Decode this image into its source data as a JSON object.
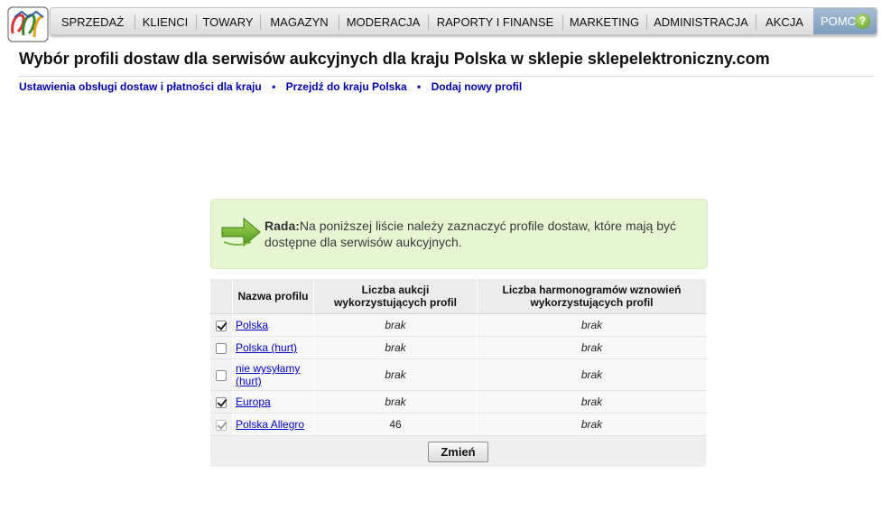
{
  "menu": {
    "items": [
      {
        "label": "SPRZEDAŻ",
        "name": "menu-item-sprzedaz"
      },
      {
        "label": "KLIENCI",
        "name": "menu-item-klienci"
      },
      {
        "label": "TOWARY",
        "name": "menu-item-towary"
      },
      {
        "label": "MAGAZYN",
        "name": "menu-item-magazyn"
      },
      {
        "label": "MODERACJA",
        "name": "menu-item-moderacja"
      },
      {
        "label": "RAPORTY I FINANSE",
        "name": "menu-item-raporty-i-finanse"
      },
      {
        "label": "MARKETING",
        "name": "menu-item-marketing"
      },
      {
        "label": "ADMINISTRACJA",
        "name": "menu-item-administracja"
      },
      {
        "label": "AKCJA",
        "name": "menu-item-akcja"
      }
    ],
    "help_label": "POMOC",
    "help_icon": "question-icon",
    "help_color": "#7d9bbc"
  },
  "page": {
    "title": "Wybór profili dostaw dla serwisów aukcyjnych dla kraju Polska w sklepie sklepelektroniczny.com"
  },
  "links": [
    {
      "label": "Ustawienia obsługi dostaw i płatności dla kraju",
      "name": "link-ustawienia-dostaw"
    },
    {
      "label": "Przejdź do kraju Polska",
      "name": "link-przejdz-do-kraju"
    },
    {
      "label": "Dodaj nowy profil",
      "name": "link-dodaj-profil"
    }
  ],
  "tip": {
    "label": "Rada:",
    "text": "Na poniższej liście należy zaznaczyć profile dostaw, które mają być dostępne dla serwisów aukcyjnych.",
    "icon": "green-arrow-icon",
    "background": "#e6f6d2"
  },
  "table": {
    "headers": {
      "name": "Nazwa profilu",
      "auctions": "Liczba aukcji wykorzystujących profil",
      "schedules": "Liczba harmonogramów wznowień wykorzystujących profil"
    },
    "rows": [
      {
        "name": "Polska",
        "checked": true,
        "disabled": false,
        "auctions": "brak",
        "schedules": "brak"
      },
      {
        "name": "Polska (hurt)",
        "checked": false,
        "disabled": false,
        "auctions": "brak",
        "schedules": "brak"
      },
      {
        "name": "nie wysyłamy (hurt)",
        "checked": false,
        "disabled": false,
        "auctions": "brak",
        "schedules": "brak"
      },
      {
        "name": "Europa",
        "checked": true,
        "disabled": false,
        "auctions": "brak",
        "schedules": "brak"
      },
      {
        "name": "Polska Allegro",
        "checked": true,
        "disabled": true,
        "auctions": "46",
        "schedules": "brak"
      }
    ],
    "submit_label": "Zmień"
  }
}
